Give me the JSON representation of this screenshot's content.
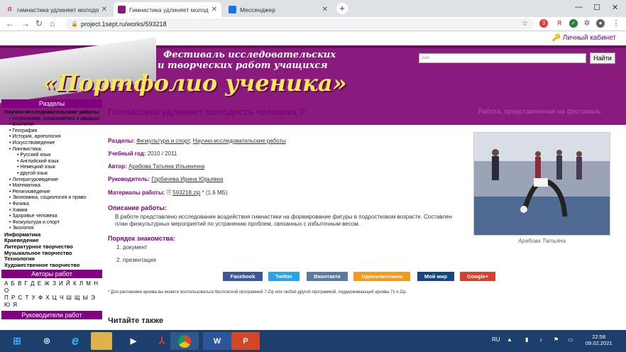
{
  "tabs": [
    {
      "icon": "Я",
      "label": "гимнастика удлиняет молодость"
    },
    {
      "icon": "",
      "label": "Гимнастика удлиняет молодость"
    },
    {
      "icon": "",
      "label": "Мессенджер"
    }
  ],
  "address": {
    "url": "project.1sept.ru/works/593218"
  },
  "extensions": {
    "badge": "3",
    "ya": "Я"
  },
  "cabinet": "Личный кабинет",
  "banner": {
    "line1": "Фестиваль исследовательских",
    "line2": "и творческих работ учащихся",
    "title": "«Портфолио ученика»",
    "search_placeholder": "Jndtc",
    "search_button": "Найти"
  },
  "sidebar": {
    "sections_head": "Разделы",
    "research_head": "Научно-исследовательские работы:",
    "research": [
      "Астрономия, космонавтика и авиация",
      "Биология",
      "География",
      "История, археология",
      "Искусствоведение",
      "Лингвистика:"
    ],
    "linguistics": [
      "Русский язык",
      "Английский язык",
      "Немецкий язык",
      "другой язык"
    ],
    "research2": [
      "Литературоведение",
      "Математика",
      "Религиоведение",
      "Экономика, социология и право",
      "Физика",
      "Химия",
      "Здоровье человека",
      "Физкультура и спорт",
      "Экология"
    ],
    "other": [
      "Информатика",
      "Краеведение",
      "Литературное творчество",
      "Музыкальное творчество",
      "Технология",
      "Художественное творчество"
    ],
    "authors_head": "Авторы работ",
    "alpha1": "А Б В Г Д Е Ж З И Й К Л М Н О",
    "alpha2": "П Р С Т У Ф Х Ц Ч Ш Щ Ы Э Ю Я",
    "leaders_head": "Руководители работ"
  },
  "main": {
    "title": "Гимнастика удлиняет молодость человека",
    "festival_note": "Работа, представленная на фестиваль",
    "sections_label": "Разделы:",
    "section1": "Физкультура и спорт",
    "section2": "Научно-исследовательские работы",
    "year_label": "Учебный год:",
    "year": "2010 / 2011",
    "author_label": "Автор:",
    "author": "Арабова Татьяна Ильинична",
    "leader_label": "Руководитель:",
    "leader": "Горбачева Ирина Юрьевна",
    "materials_label": "Материалы работы:",
    "file": "593218.zip",
    "file_size": "* (1,6 МБ)",
    "desc_head": "Описание работы:",
    "desc_text": "В работе представлено исследование воздействия гимнастики на формирование фигуры в подростковом возрасте. Составлен план физкультурных мероприятий по устранению проблем, связанных с избыточным весом.",
    "order_head": "Порядок знакомства:",
    "order": [
      "1. документ",
      "2. презентация"
    ],
    "photo_caption": "Арабова Татьяна",
    "footnote": "* Для распаковки архива вы можете воспользоваться бесплатной программой 7-Zip или любой другой программой, поддерживающей архивы 7z и Zip.",
    "read_also": "Читайте также"
  },
  "social": [
    {
      "label": "Facebook",
      "color": "#3b5998"
    },
    {
      "label": "Twitter",
      "color": "#2aa3ef"
    },
    {
      "label": "Вконтакте",
      "color": "#5a7aa0"
    },
    {
      "label": "Одноклассники",
      "color": "#f39a1e"
    },
    {
      "label": "Мой мир",
      "color": "#16467e"
    },
    {
      "label": "Google+",
      "color": "#d8412f"
    }
  ],
  "taskbar": {
    "lang": "RU",
    "time": "22:58",
    "date": "09.02.2021"
  }
}
